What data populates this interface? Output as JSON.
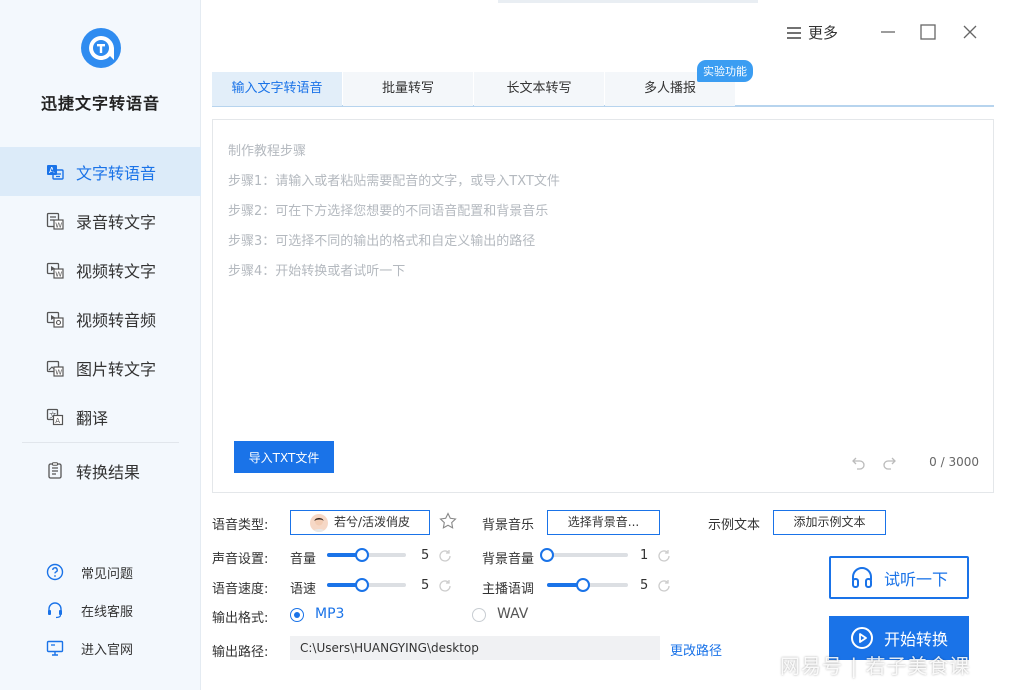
{
  "app": {
    "name": "迅捷文字转语音",
    "accent": "#1a73e8"
  },
  "sidebar": {
    "items": [
      {
        "label": "文字转语音",
        "icon": "text-to-speech-icon",
        "active": true
      },
      {
        "label": "录音转文字",
        "icon": "audio-to-text-icon"
      },
      {
        "label": "视频转文字",
        "icon": "video-to-text-icon"
      },
      {
        "label": "视频转音频",
        "icon": "video-to-audio-icon"
      },
      {
        "label": "图片转文字",
        "icon": "image-to-text-icon"
      },
      {
        "label": "翻译",
        "icon": "translate-icon"
      },
      {
        "label": "转换结果",
        "icon": "results-icon"
      }
    ],
    "footer": [
      {
        "label": "常见问题",
        "icon": "question-icon"
      },
      {
        "label": "在线客服",
        "icon": "headset-icon"
      },
      {
        "label": "进入官网",
        "icon": "monitor-icon"
      }
    ]
  },
  "window": {
    "more_label": "更多"
  },
  "tabs": [
    {
      "label": "输入文字转语音",
      "active": true
    },
    {
      "label": "批量转写"
    },
    {
      "label": "长文本转写"
    },
    {
      "label": "多人播报"
    }
  ],
  "badge": "实验功能",
  "editor": {
    "guide_title": "制作教程步骤",
    "steps": [
      "步骤1：请输入或者粘贴需要配音的文字，或导入TXT文件",
      "步骤2：可在下方选择您想要的不同语音配置和背景音乐",
      "步骤3：可选择不同的输出的格式和自定义输出的路径",
      "步骤4：开始转换或者试听一下"
    ],
    "import_label": "导入TXT文件",
    "counter": "0 / 3000"
  },
  "settings": {
    "voice_type_label": "语音类型:",
    "voice_name": "若兮/活泼俏皮",
    "bg_music_label": "背景音乐",
    "bg_music_button": "选择背景音...",
    "sample_text_label": "示例文本",
    "sample_text_button": "添加示例文本",
    "sound_label": "声音设置:",
    "volume_label": "音量",
    "volume_value": "5",
    "volume_level": 0.44,
    "bg_volume_label": "背景音量",
    "bg_volume_value": "1",
    "bg_volume_level": 0.0,
    "speed_section_label": "语音速度:",
    "speed_label": "语速",
    "speed_value": "5",
    "speed_level": 0.44,
    "pitch_label": "主播语调",
    "pitch_value": "5",
    "pitch_level": 0.44,
    "format_label": "输出格式:",
    "format_mp3": "MP3",
    "format_wav": "WAV",
    "format_selected": "MP3",
    "path_label": "输出路径:",
    "path_value": "C:\\Users\\HUANGYING\\desktop",
    "change_path": "更改路径"
  },
  "actions": {
    "listen_label": "试听一下",
    "start_label": "开始转换"
  },
  "watermark": "网易号 | 若子美食课"
}
